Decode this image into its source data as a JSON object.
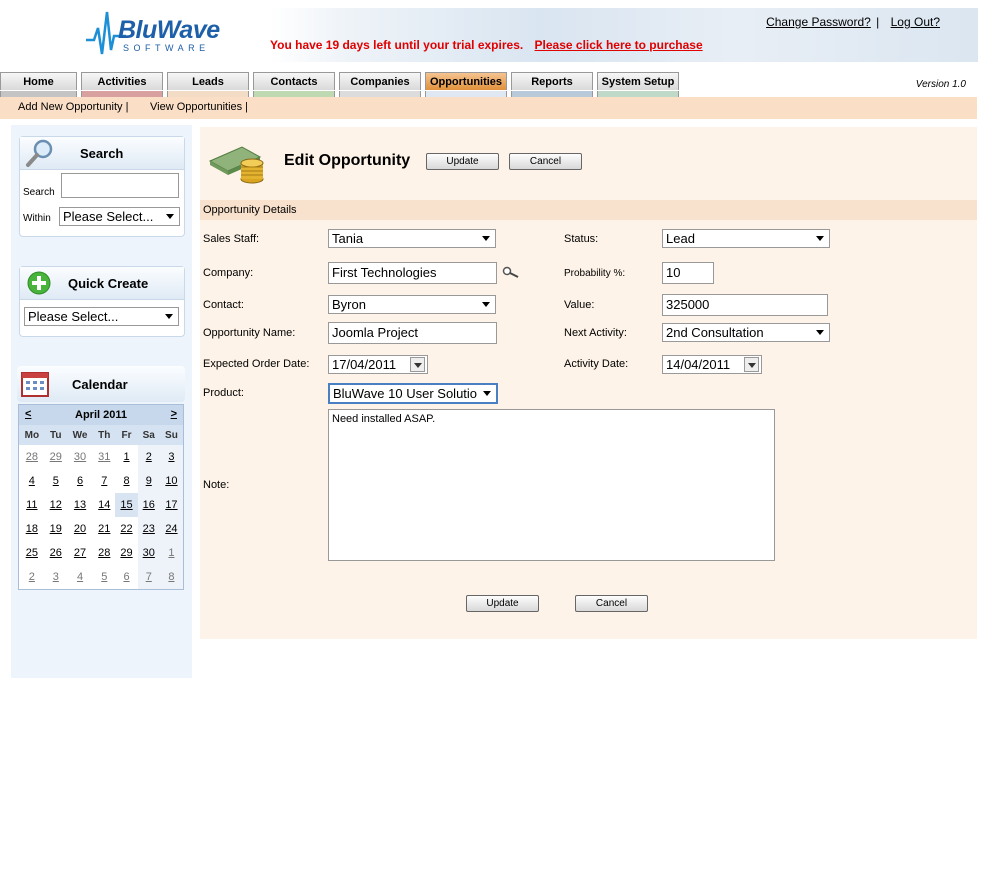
{
  "header": {
    "logo_name": "BluWave",
    "logo_sub": "SOFTWARE",
    "trial_text": "You have 19 days left until your trial expires.",
    "trial_link": "Please click here to purchase",
    "change_password": "Change Password?",
    "separator": "|",
    "log_out": "Log Out?"
  },
  "tabs": [
    {
      "label": "Home",
      "color": "#c4c4c4"
    },
    {
      "label": "Activities",
      "color": "#d9a0a0"
    },
    {
      "label": "Leads",
      "color": "#f2dcc6"
    },
    {
      "label": "Contacts",
      "color": "#bfd9b3"
    },
    {
      "label": "Companies",
      "color": "#dcdcdc"
    },
    {
      "label": "Opportunities",
      "color": "#dfe8f2"
    },
    {
      "label": "Reports",
      "color": "#b8c9da"
    },
    {
      "label": "System Setup",
      "color": "#bfd9c8"
    }
  ],
  "version": "Version 1.0",
  "subnav": {
    "add": "Add New Opportunity |",
    "view": "View Opportunities |"
  },
  "sidebar": {
    "search": {
      "title": "Search",
      "search_label": "Search",
      "within_label": "Within",
      "search_value": "",
      "within_value": "Please Select..."
    },
    "quick_create": {
      "title": "Quick Create",
      "value": "Please Select..."
    },
    "calendar": {
      "title": "Calendar",
      "prev": "<",
      "next": ">",
      "month": "April 2011",
      "days": [
        "Mo",
        "Tu",
        "We",
        "Th",
        "Fr",
        "Sa",
        "Su"
      ],
      "weeks": [
        [
          "28",
          "29",
          "30",
          "31",
          "1",
          "2",
          "3"
        ],
        [
          "4",
          "5",
          "6",
          "7",
          "8",
          "9",
          "10"
        ],
        [
          "11",
          "12",
          "13",
          "14",
          "15",
          "16",
          "17"
        ],
        [
          "18",
          "19",
          "20",
          "21",
          "22",
          "23",
          "24"
        ],
        [
          "25",
          "26",
          "27",
          "28",
          "29",
          "30",
          "1"
        ],
        [
          "2",
          "3",
          "4",
          "5",
          "6",
          "7",
          "8"
        ]
      ]
    }
  },
  "main": {
    "title": "Edit Opportunity",
    "update": "Update",
    "cancel": "Cancel",
    "section": "Opportunity Details",
    "fields": {
      "sales_staff_label": "Sales Staff:",
      "sales_staff": "Tania",
      "status_label": "Status:",
      "status": "Lead",
      "company_label": "Company:",
      "company": "First Technologies",
      "probability_label": "Probability %:",
      "probability": "10",
      "contact_label": "Contact:",
      "contact": "Byron",
      "value_label": "Value:",
      "value": "325000",
      "name_label": "Opportunity Name:",
      "name": "Joomla Project",
      "next_activity_label": "Next Activity:",
      "next_activity": "2nd Consultation",
      "order_date_label": "Expected Order Date:",
      "order_date": "17/04/2011",
      "activity_date_label": "Activity Date:",
      "activity_date": "14/04/2011",
      "product_label": "Product:",
      "product": "BluWave 10 User Solutio",
      "note_label": "Note:",
      "note": "Need installed ASAP."
    }
  }
}
